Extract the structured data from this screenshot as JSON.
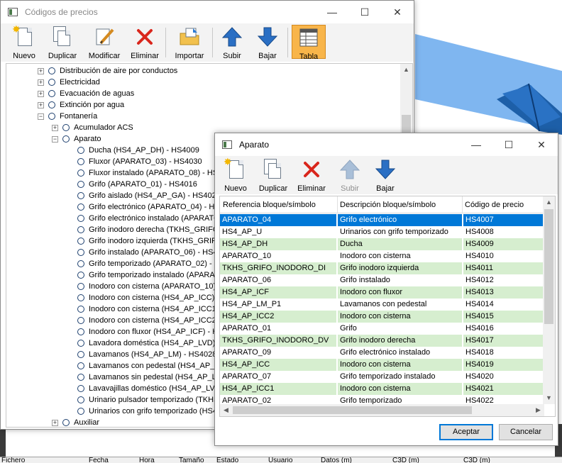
{
  "main_window": {
    "title": "Códigos de precios",
    "toolbar": [
      {
        "label": "Nuevo",
        "icon": "new-doc-icon"
      },
      {
        "label": "Duplicar",
        "icon": "duplicate-icon"
      },
      {
        "label": "Modificar",
        "icon": "edit-icon"
      },
      {
        "label": "Eliminar",
        "icon": "delete-icon"
      },
      {
        "label": "Importar",
        "icon": "import-folder-icon"
      },
      {
        "label": "Subir",
        "icon": "arrow-up-icon"
      },
      {
        "label": "Bajar",
        "icon": "arrow-down-icon"
      },
      {
        "label": "Tabla",
        "icon": "table-icon",
        "selected": true
      }
    ],
    "tree": [
      {
        "label": "Distribución de aire por conductos",
        "level": 0,
        "expander": "+"
      },
      {
        "label": "Electricidad",
        "level": 0,
        "expander": "+"
      },
      {
        "label": "Evacuación de aguas",
        "level": 0,
        "expander": "+"
      },
      {
        "label": "Extinción por agua",
        "level": 0,
        "expander": "+"
      },
      {
        "label": "Fontanería",
        "level": 0,
        "expander": "-"
      },
      {
        "label": "Acumulador ACS",
        "level": 1,
        "expander": "+"
      },
      {
        "label": "Aparato",
        "level": 1,
        "expander": "-"
      },
      {
        "label": "Ducha (HS4_AP_DH) - HS4009",
        "level": 2
      },
      {
        "label": "Fluxor (APARATO_03) - HS4030",
        "level": 2
      },
      {
        "label": "Fluxor instalado (APARATO_08) - HS",
        "level": 2
      },
      {
        "label": "Grifo (APARATO_01) - HS4016",
        "level": 2
      },
      {
        "label": "Grifo aislado (HS4_AP_GA) - HS4023",
        "level": 2
      },
      {
        "label": "Grifo electrónico (APARATO_04) - HS",
        "level": 2
      },
      {
        "label": "Grifo electrónico instalado (APARATO",
        "level": 2
      },
      {
        "label": "Grifo inodoro derecha (TKHS_GRIFO_",
        "level": 2
      },
      {
        "label": "Grifo inodoro izquierda (TKHS_GRIFO",
        "level": 2
      },
      {
        "label": "Grifo instalado (APARATO_06) - HS4",
        "level": 2
      },
      {
        "label": "Grifo temporizado (APARATO_02) - H",
        "level": 2
      },
      {
        "label": "Grifo temporizado instalado (APARAT",
        "level": 2
      },
      {
        "label": "Inodoro con cisterna (APARATO_10)",
        "level": 2
      },
      {
        "label": "Inodoro con cisterna (HS4_AP_ICC)",
        "level": 2
      },
      {
        "label": "Inodoro con cisterna (HS4_AP_ICC1",
        "level": 2
      },
      {
        "label": "Inodoro con cisterna (HS4_AP_ICC2",
        "level": 2
      },
      {
        "label": "Inodoro con fluxor (HS4_AP_ICF) - H",
        "level": 2
      },
      {
        "label": "Lavadora doméstica (HS4_AP_LVD) -",
        "level": 2
      },
      {
        "label": "Lavamanos (HS4_AP_LM) - HS4028",
        "level": 2
      },
      {
        "label": "Lavamanos con pedestal (HS4_AP_LI",
        "level": 2
      },
      {
        "label": "Lavamanos sin pedestal (HS4_AP_LM",
        "level": 2
      },
      {
        "label": "Lavavajillas doméstico (HS4_AP_LVV",
        "level": 2
      },
      {
        "label": "Urinario pulsador temporizado (TKHS",
        "level": 2
      },
      {
        "label": "Urinarios con grifo temporizado (HS4",
        "level": 2
      },
      {
        "label": "Auxiliar",
        "level": 1,
        "expander": "+"
      }
    ]
  },
  "dialog": {
    "title": "Aparato",
    "toolbar": [
      {
        "label": "Nuevo",
        "icon": "new-doc-icon",
        "disabled": false
      },
      {
        "label": "Duplicar",
        "icon": "duplicate-icon",
        "disabled": false
      },
      {
        "label": "Eliminar",
        "icon": "delete-icon",
        "disabled": false
      },
      {
        "label": "Subir",
        "icon": "arrow-up-icon",
        "disabled": true
      },
      {
        "label": "Bajar",
        "icon": "arrow-down-icon",
        "disabled": false
      }
    ],
    "columns": [
      "Referencia bloque/símbolo",
      "Descripción bloque/símbolo",
      "Código de precio"
    ],
    "rows": [
      {
        "ref": "APARATO_04",
        "desc": "Grifo electrónico",
        "code": "HS4007",
        "style": "sel"
      },
      {
        "ref": "HS4_AP_U",
        "desc": "Urinarios con grifo temporizado",
        "code": "HS4008",
        "style": "plain"
      },
      {
        "ref": "HS4_AP_DH",
        "desc": "Ducha",
        "code": "HS4009",
        "style": "green"
      },
      {
        "ref": "APARATO_10",
        "desc": "Inodoro con cisterna",
        "code": "HS4010",
        "style": "plain"
      },
      {
        "ref": "TKHS_GRIFO_INODORO_DI",
        "desc": "Grifo inodoro izquierda",
        "code": "HS4011",
        "style": "green"
      },
      {
        "ref": "APARATO_06",
        "desc": "Grifo instalado",
        "code": "HS4012",
        "style": "plain"
      },
      {
        "ref": "HS4_AP_ICF",
        "desc": "Inodoro con fluxor",
        "code": "HS4013",
        "style": "green"
      },
      {
        "ref": "HS4_AP_LM_P1",
        "desc": "Lavamanos con pedestal",
        "code": "HS4014",
        "style": "plain"
      },
      {
        "ref": "HS4_AP_ICC2",
        "desc": "Inodoro con cisterna",
        "code": "HS4015",
        "style": "green"
      },
      {
        "ref": "APARATO_01",
        "desc": "Grifo",
        "code": "HS4016",
        "style": "plain"
      },
      {
        "ref": "TKHS_GRIFO_INODORO_DV",
        "desc": "Grifo inodoro derecha",
        "code": "HS4017",
        "style": "green"
      },
      {
        "ref": "APARATO_09",
        "desc": "Grifo electrónico instalado",
        "code": "HS4018",
        "style": "plain"
      },
      {
        "ref": "HS4_AP_ICC",
        "desc": "Inodoro con cisterna",
        "code": "HS4019",
        "style": "green"
      },
      {
        "ref": "APARATO_07",
        "desc": "Grifo temporizado instalado",
        "code": "HS4020",
        "style": "plain"
      },
      {
        "ref": "HS4_AP_ICC1",
        "desc": "Inodoro con cisterna",
        "code": "HS4021",
        "style": "green"
      },
      {
        "ref": "APARATO_02",
        "desc": "Grifo temporizado",
        "code": "HS4022",
        "style": "plain"
      }
    ],
    "ok_label": "Aceptar",
    "cancel_label": "Cancelar"
  },
  "background": {
    "status_columns": [
      "Fichero",
      "Fecha",
      "Hora",
      "Tamaño",
      "Estado",
      "Usuario",
      "Datos (m)",
      "C3D (m)",
      "C3D (m)"
    ]
  },
  "colors": {
    "selected_row": "#0078d7",
    "alt_row": "#d6eecf",
    "selected_tool": "#f8b54a",
    "tree_node": "#1c3f6e"
  }
}
